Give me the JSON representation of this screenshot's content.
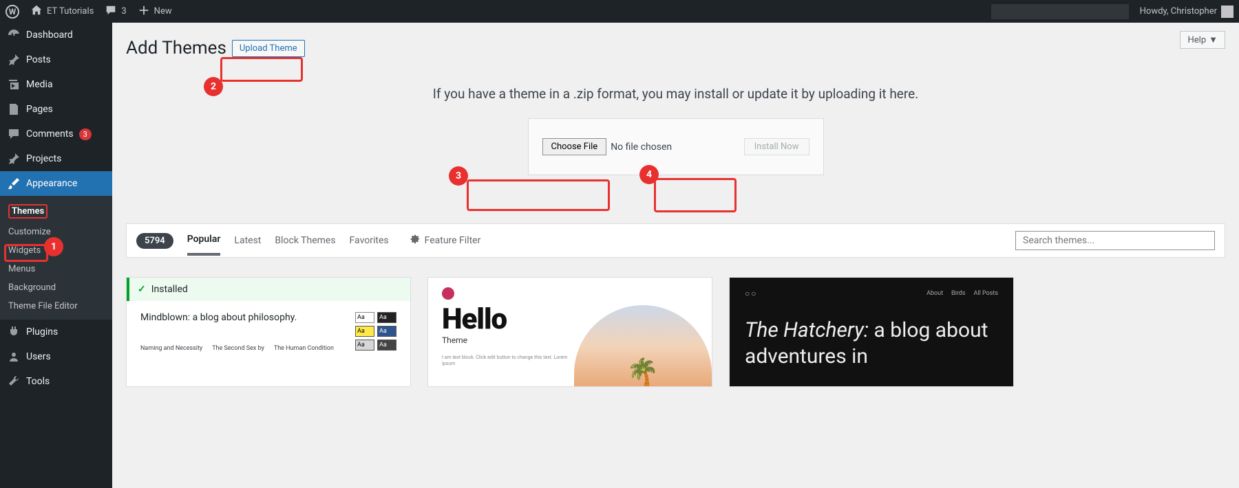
{
  "adminbar": {
    "site_name": "ET Tutorials",
    "comments_count": "3",
    "new_label": "New",
    "howdy": "Howdy, Christopher"
  },
  "sidebar": {
    "items": [
      {
        "label": "Dashboard"
      },
      {
        "label": "Posts"
      },
      {
        "label": "Media"
      },
      {
        "label": "Pages"
      },
      {
        "label": "Comments",
        "count": "3"
      },
      {
        "label": "Projects"
      },
      {
        "label": "Appearance"
      },
      {
        "label": "Plugins"
      },
      {
        "label": "Users"
      },
      {
        "label": "Tools"
      }
    ],
    "appearance_sub": [
      {
        "label": "Themes",
        "current": true
      },
      {
        "label": "Customize"
      },
      {
        "label": "Widgets"
      },
      {
        "label": "Menus"
      },
      {
        "label": "Background"
      },
      {
        "label": "Theme File Editor"
      }
    ]
  },
  "page": {
    "title": "Add Themes",
    "upload_btn": "Upload Theme",
    "help_btn": "Help",
    "upload_msg": "If you have a theme in a .zip format, you may install or update it by uploading it here.",
    "choose_file": "Choose File",
    "no_file": "No file chosen",
    "install_now": "Install Now"
  },
  "filters": {
    "count": "5794",
    "tabs": [
      "Popular",
      "Latest",
      "Block Themes",
      "Favorites"
    ],
    "feature_filter": "Feature Filter",
    "search_placeholder": "Search themes..."
  },
  "themes": {
    "installed_label": "Installed",
    "t1": {
      "title": "Mindblown: a blog about philosophy.",
      "c1": "Naming and Necessity",
      "c2": "The Second Sex by",
      "c3": "The Human Condition",
      "swatch": "Aa"
    },
    "t2": {
      "big": "Hello",
      "sub": "Theme",
      "lorem": "I am text block. Click edit button to change this text. Lorem ipsum"
    },
    "t3": {
      "logo": "○○",
      "nav": [
        "About",
        "Birds",
        "All Posts"
      ],
      "title_ital": "The Hatchery:",
      "title_rest": " a blog about adventures in"
    }
  },
  "annotations": {
    "n1": "1",
    "n2": "2",
    "n3": "3",
    "n4": "4"
  }
}
